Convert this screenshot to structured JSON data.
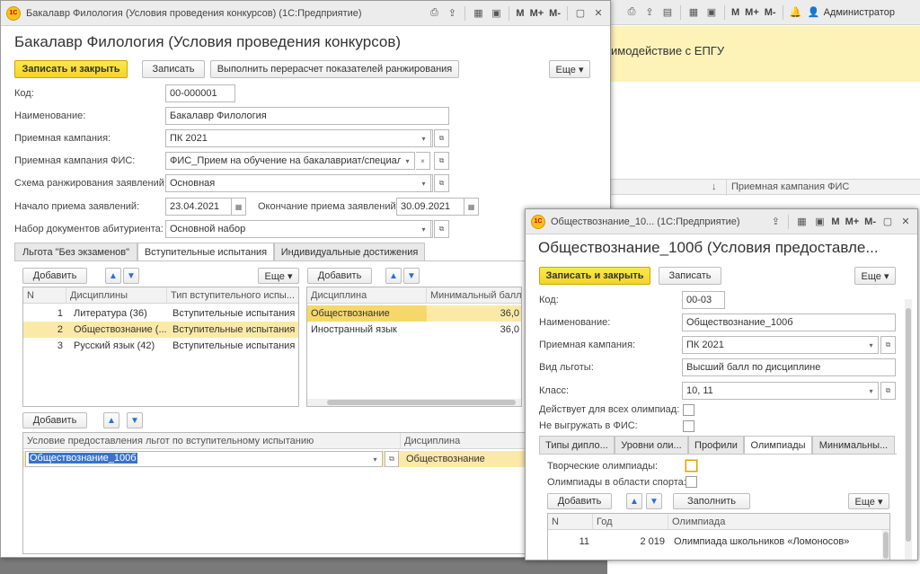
{
  "bg": {
    "banner_text": "имодействие с ЕПГУ",
    "sort_icon": "↓",
    "column_header": "Приемная кампания ФИС",
    "titlebar": {
      "m": "M",
      "mplus": "M+",
      "mminus": "M-",
      "user": "Администратор"
    }
  },
  "main": {
    "window_title": "Бакалавр Филология (Условия проведения конкурсов)  (1С:Предприятие)",
    "logo": "1С",
    "heading": "Бакалавр Филология (Условия проведения конкурсов)",
    "buttons": {
      "save_close": "Записать и закрыть",
      "save": "Записать",
      "recalc": "Выполнить перерасчет показателей ранжирования",
      "more": "Еще ▾"
    },
    "titlebar": {
      "m": "M",
      "mplus": "M+",
      "mminus": "M-"
    },
    "fields": {
      "code_label": "Код:",
      "code": "00-000001",
      "name_label": "Наименование:",
      "name": "Бакалавр Филология",
      "campaign_label": "Приемная кампания:",
      "campaign": "ПК 2021",
      "fis_label": "Приемная кампания ФИС:",
      "fis": "ФИС_Прием на обучение на бакалавриат/специалит",
      "scheme_label": "Схема ранжирования заявлений:",
      "scheme": "Основная",
      "start_label": "Начало приема заявлений:",
      "start": "23.04.2021",
      "end_label": "Окончание приема заявлений:",
      "end": "30.09.2021",
      "docs_label": "Набор документов абитуриента:",
      "docs": "Основной набор"
    },
    "tabs": [
      "Льгота \"Без экзаменов\"",
      "Вступительные испытания",
      "Индивидуальные достижения"
    ],
    "left_grid": {
      "add": "Добавить",
      "more": "Еще ▾",
      "headers": [
        "N",
        "Дисциплины",
        "Тип вступительного испы..."
      ],
      "rows": [
        {
          "n": "1",
          "disc": "Литература (36)",
          "type": "Вступительные испытания"
        },
        {
          "n": "2",
          "disc": "Обществознание (...",
          "type": "Вступительные испытания"
        },
        {
          "n": "3",
          "disc": "Русский язык (42)",
          "type": "Вступительные испытания"
        }
      ]
    },
    "right_grid": {
      "add": "Добавить",
      "headers": [
        "Дисциплина",
        "Минимальный балл"
      ],
      "rows": [
        {
          "disc": "Обществознание",
          "score": "36,0"
        },
        {
          "disc": "Иностранный язык",
          "score": "36,0"
        }
      ]
    },
    "bottom_grid": {
      "add": "Добавить",
      "headers": [
        "Условие предоставления льгот по вступительному испытанию",
        "Дисциплина"
      ],
      "row": {
        "cond": "Обществознание_100б",
        "disc": "Обществознание"
      }
    }
  },
  "dialog": {
    "window_title": "Обществознание_10...  (1С:Предприятие)",
    "logo": "1С",
    "heading": "Обществознание_100б (Условия предоставле...",
    "buttons": {
      "save_close": "Записать и закрыть",
      "save": "Записать",
      "more": "Еще ▾"
    },
    "titlebar": {
      "m": "M",
      "mplus": "M+",
      "mminus": "M-"
    },
    "fields": {
      "code_label": "Код:",
      "code": "00-03",
      "name_label": "Наименование:",
      "name": "Обществознание_100б",
      "campaign_label": "Приемная кампания:",
      "campaign": "ПК 2021",
      "benefit_label": "Вид льготы:",
      "benefit": "Высший балл по дисциплине",
      "class_label": "Класс:",
      "class": "10, 11",
      "all_olymp_label": "Действует для всех олимпиад:",
      "no_export_label": "Не выгружать в ФИС:"
    },
    "tabs": [
      "Типы дипло...",
      "Уровни оли...",
      "Профили",
      "Олимпиады",
      "Минимальны..."
    ],
    "olymp": {
      "creative_label": "Творческие олимпиады:",
      "sport_label": "Олимпиады в области спорта:",
      "add": "Добавить",
      "fill": "Заполнить",
      "more": "Еще ▾",
      "headers": [
        "N",
        "Год",
        "Олимпиада"
      ],
      "row": {
        "n": "11",
        "year": "2 019",
        "name": "Олимпиада школьников «Ломоносов»"
      }
    }
  }
}
